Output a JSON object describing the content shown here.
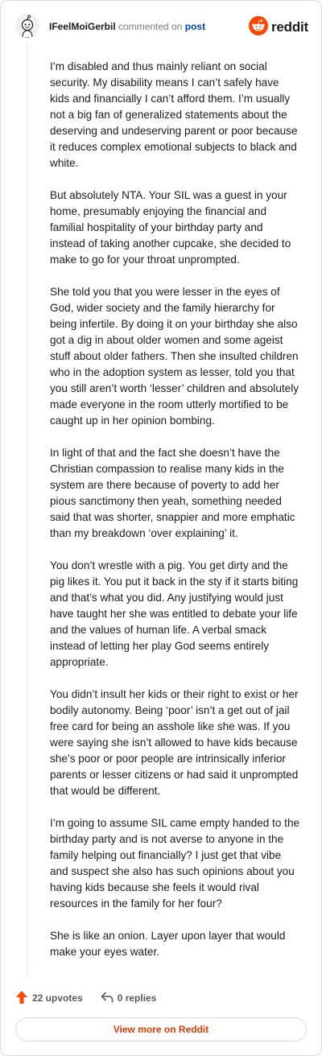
{
  "header": {
    "username": "IFeelMoiGerbil",
    "verb": "commented on",
    "post_link": "post",
    "brand_name": "reddit",
    "avatar_icon": "snoo-avatar-icon",
    "brand_icon": "reddit-logo-icon"
  },
  "comment": {
    "paragraphs": [
      "I’m disabled and thus mainly reliant on social security. My disability means I can’t safely have kids and financially I can’t afford them. I’m usually not a big fan of generalized statements about the deserving and undeserving parent or poor because it reduces complex emotional subjects to black and white.",
      "But absolutely NTA. Your SIL was a guest in your home, presumably enjoying the financial and familial hospitality of your birthday party and instead of taking another cupcake, she decided to make to go for your throat unprompted.",
      "She told you that you were lesser in the eyes of God, wider society and the family hierarchy for being infertile. By doing it on your birthday she also got a dig in about older women and some ageist stuff about older fathers. Then she insulted children who in the adoption system as lesser, told you that you still aren’t worth ‘lesser’ children and absolutely made everyone in the room utterly mortified to be caught up in her opinion bombing.",
      "In light of that and the fact she doesn’t have the Christian compassion to realise many kids in the system are there because of poverty to add her pious sanctimony then yeah, something needed said that was shorter, snappier and more emphatic than my breakdown ‘over explaining’ it.",
      "You don’t wrestle with a pig. You get dirty and the pig likes it. You put it back in the sty if it starts biting and that’s what you did. Any justifying would just have taught her she was entitled to debate your life and the values of human life. A verbal smack instead of letting her play God seems entirely appropriate.",
      "You didn’t insult her kids or their right to exist or her bodily autonomy. Being ‘poor’ isn’t a get out of jail free card for being an asshole like she was. If you were saying she isn’t allowed to have kids because she’s poor or poor people are intrinsically inferior parents or lesser citizens or had said it unprompted that would be different.",
      "I’m going to assume SIL came empty handed to the birthday party and is not averse to anyone in the family helping out financially? I just get that vibe and suspect she also has such opinions about you having kids because she feels it would rival resources in the family for her four?",
      "She is like an onion. Layer upon layer that would make your eyes water."
    ]
  },
  "actions": {
    "upvotes": "22 upvotes",
    "replies": "0 replies",
    "upvote_icon": "upvote-arrow-icon",
    "reply_icon": "reply-arrow-icon"
  },
  "footer": {
    "view_more": "View more on Reddit"
  },
  "colors": {
    "brand_orange": "#ff4500",
    "link_blue": "#0045ac",
    "view_more_text": "#d93a00"
  }
}
